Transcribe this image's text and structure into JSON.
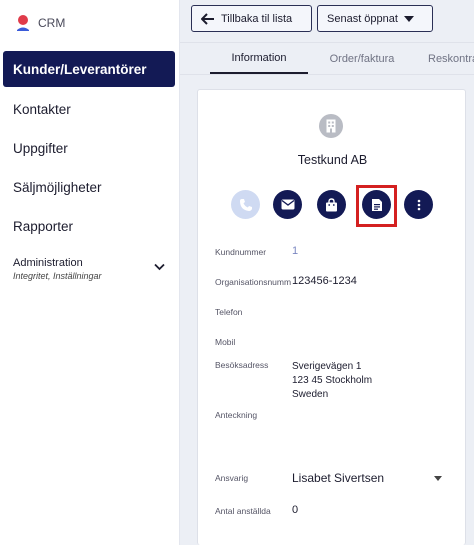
{
  "brand": {
    "label": "CRM",
    "icon": "person-pin-icon",
    "accent": "#e03b4a"
  },
  "sidebar": {
    "items": [
      {
        "label": "Kunder/Leverantörer"
      },
      {
        "label": "Kontakter"
      },
      {
        "label": "Uppgifter"
      },
      {
        "label": "Säljmöjligheter"
      },
      {
        "label": "Rapporter"
      }
    ],
    "admin": {
      "title": "Administration",
      "subtitle": "Integritet, Inställningar"
    }
  },
  "toolbar": {
    "back_label": "Tillbaka til lista",
    "recent_label": "Senast öppnat"
  },
  "tabs": [
    {
      "label": "Information",
      "active": true
    },
    {
      "label": "Order/faktura",
      "active": false
    },
    {
      "label": "Reskontra",
      "active": false
    }
  ],
  "customer": {
    "name": "Testkund AB",
    "actions": [
      {
        "icon": "phone-icon",
        "disabled": true
      },
      {
        "icon": "email-icon",
        "disabled": false
      },
      {
        "icon": "shopping-bag-icon",
        "disabled": false
      },
      {
        "icon": "document-icon",
        "disabled": false,
        "highlighted": true
      },
      {
        "icon": "more-vertical-icon",
        "disabled": false
      }
    ],
    "fields": {
      "kundnummer_label": "Kundnummer",
      "kundnummer_value": "1",
      "orgnr_label": "Organisationsnummer",
      "orgnr_value": "123456-1234",
      "telefon_label": "Telefon",
      "telefon_value": "",
      "mobil_label": "Mobil",
      "mobil_value": "",
      "address_label": "Besöksadress",
      "address_lines": [
        "Sverigevägen 1",
        "123 45 Stockholm",
        "Sweden"
      ],
      "anteckning_label": "Anteckning",
      "anteckning_value": "",
      "ansvarig_label": "Ansvarig",
      "ansvarig_value": "Lisabet Sivertsen",
      "anstallda_label": "Antal anställda",
      "anstallda_value": "0"
    }
  },
  "colors": {
    "primary": "#131a55",
    "disabled_action": "#cfdaf2",
    "highlight": "#d42020",
    "link": "#7a86c0"
  }
}
